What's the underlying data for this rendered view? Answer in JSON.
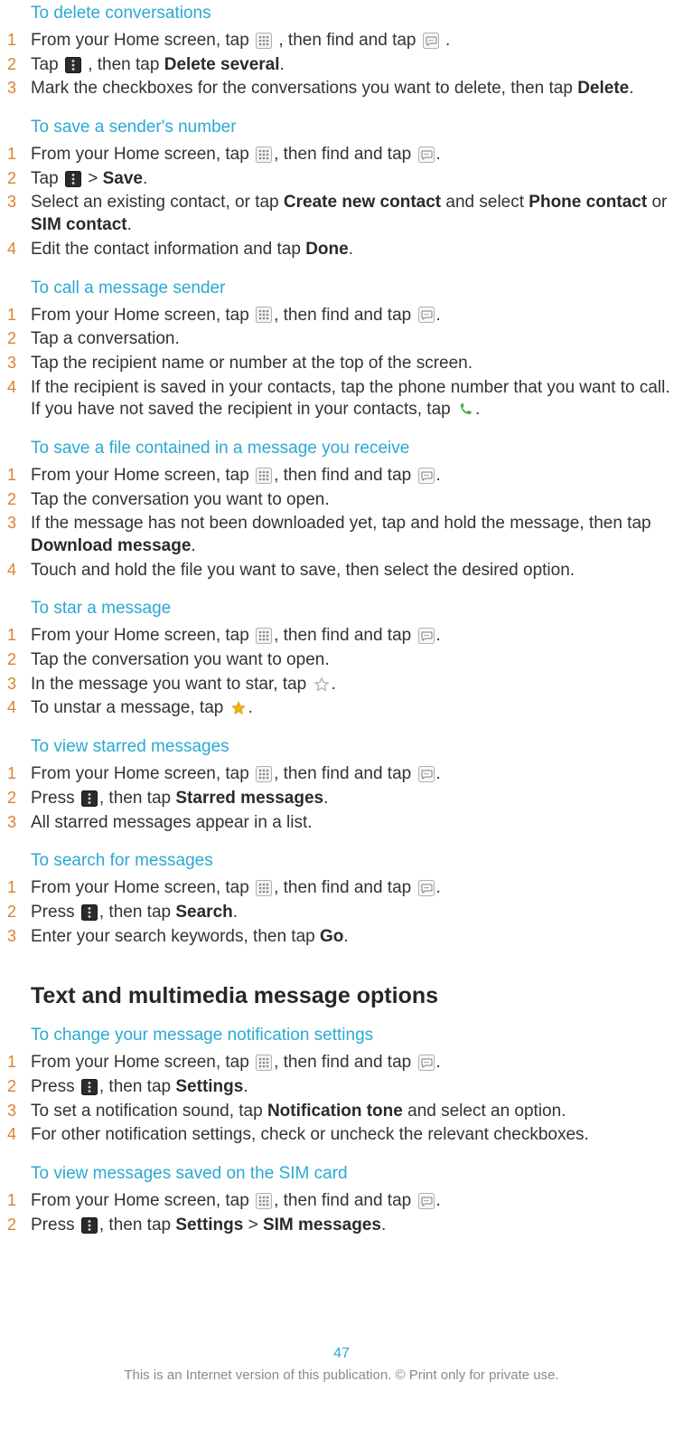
{
  "sections": [
    {
      "title": "To delete conversations",
      "first": true,
      "steps": [
        {
          "n": "1",
          "parts": [
            {
              "t": "From your Home screen, tap "
            },
            {
              "icon": "grid"
            },
            {
              "t": " , then find and tap "
            },
            {
              "icon": "msg"
            },
            {
              "t": " ."
            }
          ]
        },
        {
          "n": "2",
          "parts": [
            {
              "t": "Tap "
            },
            {
              "icon": "menu"
            },
            {
              "t": " , then tap "
            },
            {
              "b": "Delete several"
            },
            {
              "t": "."
            }
          ]
        },
        {
          "n": "3",
          "parts": [
            {
              "t": "Mark the checkboxes for the conversations you want to delete, then tap "
            },
            {
              "b": "Delete"
            },
            {
              "t": "."
            }
          ]
        }
      ]
    },
    {
      "title": "To save a sender's number",
      "steps": [
        {
          "n": "1",
          "parts": [
            {
              "t": "From your Home screen, tap "
            },
            {
              "icon": "grid"
            },
            {
              "t": ", then find and tap "
            },
            {
              "icon": "msg"
            },
            {
              "t": "."
            }
          ]
        },
        {
          "n": "2",
          "parts": [
            {
              "t": "Tap "
            },
            {
              "icon": "menu"
            },
            {
              "t": " > "
            },
            {
              "b": "Save"
            },
            {
              "t": "."
            }
          ]
        },
        {
          "n": "3",
          "parts": [
            {
              "t": "Select an existing contact, or tap "
            },
            {
              "b": "Create new contact"
            },
            {
              "t": " and select "
            },
            {
              "b": "Phone contact"
            },
            {
              "t": " or "
            },
            {
              "b": "SIM contact"
            },
            {
              "t": "."
            }
          ]
        },
        {
          "n": "4",
          "parts": [
            {
              "t": "Edit the contact information and tap "
            },
            {
              "b": "Done"
            },
            {
              "t": "."
            }
          ]
        }
      ]
    },
    {
      "title": "To call a message sender",
      "steps": [
        {
          "n": "1",
          "parts": [
            {
              "t": "From your Home screen, tap "
            },
            {
              "icon": "grid"
            },
            {
              "t": ", then find and tap "
            },
            {
              "icon": "msg"
            },
            {
              "t": "."
            }
          ]
        },
        {
          "n": "2",
          "parts": [
            {
              "t": "Tap a conversation."
            }
          ]
        },
        {
          "n": "3",
          "parts": [
            {
              "t": "Tap the recipient name or number at the top of the screen."
            }
          ]
        },
        {
          "n": "4",
          "parts": [
            {
              "t": "If the recipient is saved in your contacts, tap the phone number that you want to call. If you have not saved the recipient in your contacts, tap "
            },
            {
              "icon": "phone"
            },
            {
              "t": "."
            }
          ]
        }
      ]
    },
    {
      "title": "To save a file contained in a message you receive",
      "steps": [
        {
          "n": "1",
          "parts": [
            {
              "t": "From your Home screen, tap "
            },
            {
              "icon": "grid"
            },
            {
              "t": ", then find and tap "
            },
            {
              "icon": "msg"
            },
            {
              "t": "."
            }
          ]
        },
        {
          "n": "2",
          "parts": [
            {
              "t": "Tap the conversation you want to open."
            }
          ]
        },
        {
          "n": "3",
          "parts": [
            {
              "t": "If the message has not been downloaded yet, tap and hold the message, then tap "
            },
            {
              "b": "Download message"
            },
            {
              "t": "."
            }
          ]
        },
        {
          "n": "4",
          "parts": [
            {
              "t": "Touch and hold the file you want to save, then select the desired option."
            }
          ]
        }
      ]
    },
    {
      "title": "To star a message",
      "steps": [
        {
          "n": "1",
          "parts": [
            {
              "t": "From your Home screen, tap "
            },
            {
              "icon": "grid"
            },
            {
              "t": ", then find and tap "
            },
            {
              "icon": "msg"
            },
            {
              "t": "."
            }
          ]
        },
        {
          "n": "2",
          "parts": [
            {
              "t": "Tap the conversation you want to open."
            }
          ]
        },
        {
          "n": "3",
          "parts": [
            {
              "t": "In the message you want to star, tap "
            },
            {
              "icon": "star-outline"
            },
            {
              "t": "."
            }
          ]
        },
        {
          "n": "4",
          "parts": [
            {
              "t": "To unstar a message, tap "
            },
            {
              "icon": "star-fill"
            },
            {
              "t": "."
            }
          ]
        }
      ]
    },
    {
      "title": "To view starred messages",
      "steps": [
        {
          "n": "1",
          "parts": [
            {
              "t": "From your Home screen, tap "
            },
            {
              "icon": "grid"
            },
            {
              "t": ", then find and tap "
            },
            {
              "icon": "msg"
            },
            {
              "t": "."
            }
          ]
        },
        {
          "n": "2",
          "parts": [
            {
              "t": "Press "
            },
            {
              "icon": "menu"
            },
            {
              "t": ", then tap "
            },
            {
              "b": "Starred messages"
            },
            {
              "t": "."
            }
          ]
        },
        {
          "n": "3",
          "parts": [
            {
              "t": "All starred messages appear in a list."
            }
          ]
        }
      ]
    },
    {
      "title": "To search for messages",
      "steps": [
        {
          "n": "1",
          "parts": [
            {
              "t": "From your Home screen, tap "
            },
            {
              "icon": "grid"
            },
            {
              "t": ", then find and tap "
            },
            {
              "icon": "msg"
            },
            {
              "t": "."
            }
          ]
        },
        {
          "n": "2",
          "parts": [
            {
              "t": "Press "
            },
            {
              "icon": "menu"
            },
            {
              "t": ", then tap "
            },
            {
              "b": "Search"
            },
            {
              "t": "."
            }
          ]
        },
        {
          "n": "3",
          "parts": [
            {
              "t": "Enter your search keywords, then tap "
            },
            {
              "b": "Go"
            },
            {
              "t": "."
            }
          ]
        }
      ]
    }
  ],
  "heading": "Text and multimedia message options",
  "sections2": [
    {
      "title": "To change your message notification settings",
      "steps": [
        {
          "n": "1",
          "parts": [
            {
              "t": "From your Home screen, tap "
            },
            {
              "icon": "grid"
            },
            {
              "t": ", then find and tap "
            },
            {
              "icon": "msg"
            },
            {
              "t": "."
            }
          ]
        },
        {
          "n": "2",
          "parts": [
            {
              "t": "Press "
            },
            {
              "icon": "menu"
            },
            {
              "t": ", then tap "
            },
            {
              "b": "Settings"
            },
            {
              "t": "."
            }
          ]
        },
        {
          "n": "3",
          "parts": [
            {
              "t": "To set a notification sound, tap "
            },
            {
              "b": "Notification tone"
            },
            {
              "t": " and select an option."
            }
          ]
        },
        {
          "n": "4",
          "parts": [
            {
              "t": "For other notification settings, check or uncheck the relevant checkboxes."
            }
          ]
        }
      ]
    },
    {
      "title": "To view messages saved on the SIM card",
      "steps": [
        {
          "n": "1",
          "parts": [
            {
              "t": "From your Home screen, tap "
            },
            {
              "icon": "grid"
            },
            {
              "t": ", then find and tap "
            },
            {
              "icon": "msg"
            },
            {
              "t": "."
            }
          ]
        },
        {
          "n": "2",
          "parts": [
            {
              "t": "Press "
            },
            {
              "icon": "menu"
            },
            {
              "t": ", then tap "
            },
            {
              "b": "Settings"
            },
            {
              "t": " > "
            },
            {
              "b": "SIM messages"
            },
            {
              "t": "."
            }
          ]
        }
      ]
    }
  ],
  "page_number": "47",
  "footer_text": "This is an Internet version of this publication. © Print only for private use."
}
